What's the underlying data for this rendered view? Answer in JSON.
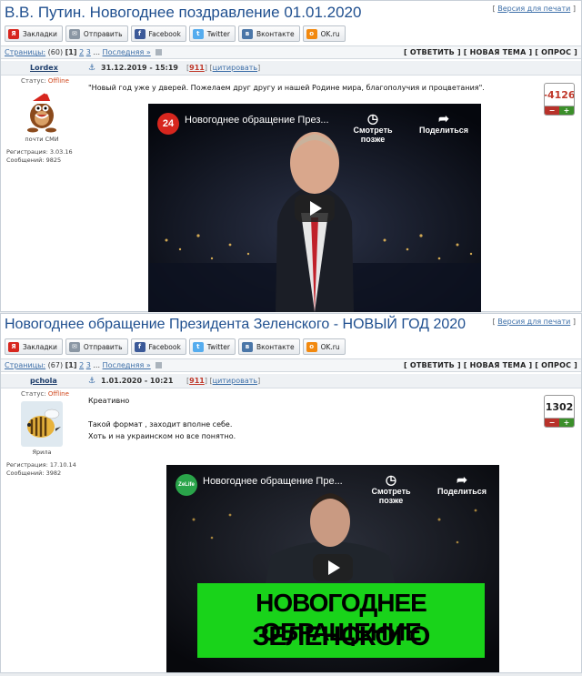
{
  "threads": [
    {
      "title": "В.В. Путин. Новогоднее поздравление 01.01.2020",
      "print_label": "Версия для печати",
      "share": [
        {
          "label": "Закладки",
          "icon": "yandex-bookmarks-icon",
          "color": "#d7261e",
          "glyph": "Я"
        },
        {
          "label": "Отправить",
          "icon": "envelope-icon",
          "color": "#8a96a3",
          "glyph": "✉"
        },
        {
          "label": "Facebook",
          "icon": "facebook-icon",
          "color": "#3b5998",
          "glyph": "f"
        },
        {
          "label": "Twitter",
          "icon": "twitter-icon",
          "color": "#55acee",
          "glyph": "t"
        },
        {
          "label": "Вконтакте",
          "icon": "vk-icon",
          "color": "#4a76a8",
          "glyph": "в"
        },
        {
          "label": "OK.ru",
          "icon": "odnoklassniki-icon",
          "color": "#f2890f",
          "glyph": "о"
        }
      ],
      "pager": {
        "label": "Страницы:",
        "count": "(60)",
        "current": "[1]",
        "p2": "2",
        "p3": "3",
        "dots": "...",
        "last": "Последняя »"
      },
      "actions": "[ ОТВЕТИТЬ ] [ НОВАЯ ТЕМА ] [ ОПРОС ]",
      "post": {
        "author": "Lordex",
        "date": "31.12.2019 - 15:19",
        "num_open": "[",
        "num": "911",
        "num_close": "]",
        "cite_open": "[",
        "cite": "цитировать",
        "cite_close": "]",
        "status_label": "Статус:",
        "status": "Offline",
        "rank": "почти СМИ",
        "reg": "Регистрация: 3.03.16",
        "msgs": "Сообщений: 9825",
        "text_lines": [
          "\"Новый год уже у дверей. Пожелаем друг другу и нашей Родине мира, благополучия и процветания\"."
        ],
        "rating": "-4126",
        "rating_color": "#c0392b",
        "video": {
          "title": "Новогоднее обращение През...",
          "watch_later": "Смотреть позже",
          "share": "Поделиться",
          "channel": "24",
          "channel_color": "#d7261e"
        }
      }
    },
    {
      "title": "Новогоднее обращение Президента Зеленского - НОВЫЙ ГОД 2020",
      "print_label": "Версия для печати",
      "share": [
        {
          "label": "Закладки",
          "icon": "yandex-bookmarks-icon",
          "color": "#d7261e",
          "glyph": "Я"
        },
        {
          "label": "Отправить",
          "icon": "envelope-icon",
          "color": "#8a96a3",
          "glyph": "✉"
        },
        {
          "label": "Facebook",
          "icon": "facebook-icon",
          "color": "#3b5998",
          "glyph": "f"
        },
        {
          "label": "Twitter",
          "icon": "twitter-icon",
          "color": "#55acee",
          "glyph": "t"
        },
        {
          "label": "Вконтакте",
          "icon": "vk-icon",
          "color": "#4a76a8",
          "glyph": "в"
        },
        {
          "label": "OK.ru",
          "icon": "odnoklassniki-icon",
          "color": "#f2890f",
          "glyph": "о"
        }
      ],
      "pager": {
        "label": "Страницы:",
        "count": "(67)",
        "current": "[1]",
        "p2": "2",
        "p3": "3",
        "dots": "...",
        "last": "Последняя »"
      },
      "actions": "[ ОТВЕТИТЬ ] [ НОВАЯ ТЕМА ] [ ОПРОС ]",
      "post": {
        "author": "pchola",
        "date": "1.01.2020 - 10:21",
        "num_open": "[",
        "num": "911",
        "num_close": "]",
        "cite_open": "[",
        "cite": "цитировать",
        "cite_close": "]",
        "status_label": "Статус:",
        "status": "Offline",
        "rank": "Ярила",
        "reg": "Регистрация: 17.10.14",
        "msgs": "Сообщений: 3982",
        "text_lines": [
          "Креативно",
          "",
          "Такой формат , заходит вполне себе.",
          "Хоть и на украинском но все понятно."
        ],
        "rating": "1302",
        "rating_color": "#222222",
        "video": {
          "title": "Новогоднее обращение Пре...",
          "watch_later": "Смотреть позже",
          "share": "Поделиться",
          "channel": "ZeLife",
          "channel_color": "#2aa44a",
          "banner_line1": "НОВОГОДНЕЕ ОБРАЩЕНИЕ",
          "banner_line2": "ЗЕЛЕНСКОГО"
        }
      }
    }
  ]
}
